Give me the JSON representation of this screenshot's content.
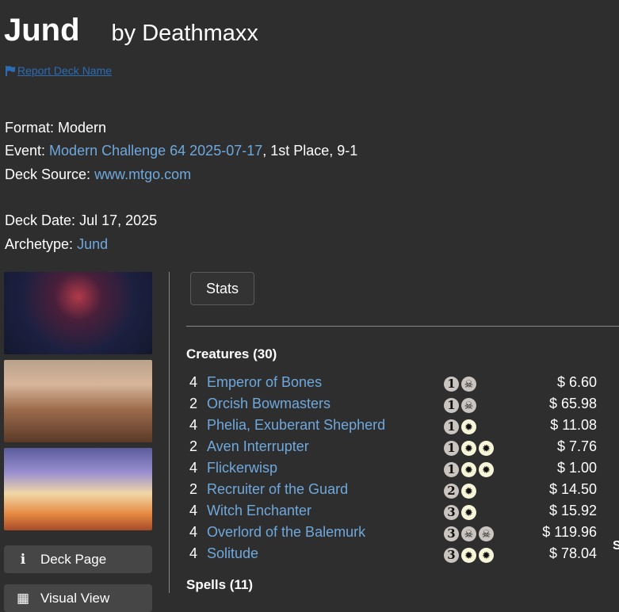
{
  "deck": {
    "name": "Jund",
    "author": "by Deathmaxx"
  },
  "report_link": {
    "label": "Report Deck Name"
  },
  "format": {
    "label": "Format:",
    "value": "Modern"
  },
  "event": {
    "label": "Event:",
    "name": "Modern Challenge 64 2025-07-17",
    "result": ", 1st Place, 9-1"
  },
  "source": {
    "label": "Deck Source:",
    "value": "www.mtgo.com"
  },
  "deck_date": {
    "label": "Deck Date:",
    "value": "Jul 17, 2025"
  },
  "archetype": {
    "label": "Archetype:",
    "value": "Jund"
  },
  "sidebar": {
    "deck_page": {
      "icon": "info-icon",
      "label": "Deck Page"
    },
    "visual_view": {
      "icon": "grid-icon",
      "label": "Visual View"
    }
  },
  "stats_button": {
    "label": "Stats"
  },
  "creatures": {
    "title": "Creatures (30)",
    "cards": [
      {
        "qty": "4",
        "name": "Emperor of Bones",
        "mana": [
          "1",
          "B"
        ],
        "price": "$ 6.60"
      },
      {
        "qty": "2",
        "name": "Orcish Bowmasters",
        "mana": [
          "1",
          "B"
        ],
        "price": "$ 65.98"
      },
      {
        "qty": "4",
        "name": "Phelia, Exuberant Shepherd",
        "mana": [
          "1",
          "W"
        ],
        "price": "$ 11.08"
      },
      {
        "qty": "2",
        "name": "Aven Interrupter",
        "mana": [
          "1",
          "W",
          "W"
        ],
        "price": "$ 7.76"
      },
      {
        "qty": "4",
        "name": "Flickerwisp",
        "mana": [
          "1",
          "W",
          "W"
        ],
        "price": "$ 1.00"
      },
      {
        "qty": "2",
        "name": "Recruiter of the Guard",
        "mana": [
          "2",
          "W"
        ],
        "price": "$ 14.50"
      },
      {
        "qty": "4",
        "name": "Witch Enchanter",
        "mana": [
          "3",
          "W"
        ],
        "price": "$ 15.92"
      },
      {
        "qty": "4",
        "name": "Overlord of the Balemurk",
        "mana": [
          "3",
          "B",
          "B"
        ],
        "price": "$ 119.96"
      },
      {
        "qty": "4",
        "name": "Solitude",
        "mana": [
          "3",
          "W",
          "W"
        ],
        "price": "$ 78.04"
      }
    ]
  },
  "spells": {
    "title": "Spells (11)"
  },
  "right_edge": {
    "fragment": "S"
  }
}
